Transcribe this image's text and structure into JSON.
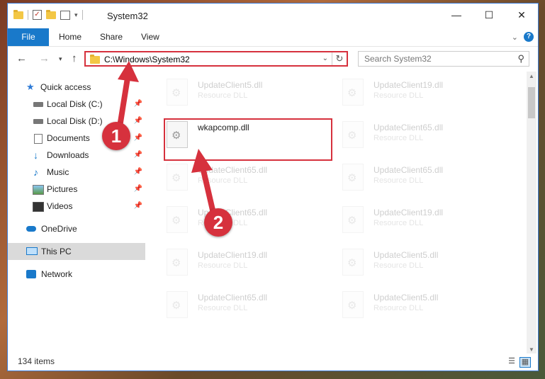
{
  "window": {
    "title": "System32"
  },
  "ribbon": {
    "tabs": {
      "file": "File",
      "home": "Home",
      "share": "Share",
      "view": "View"
    }
  },
  "nav": {
    "address": "C:\\Windows\\System32",
    "search_placeholder": "Search System32"
  },
  "sidebar": {
    "items": [
      {
        "label": "Quick access",
        "icon": "star-icon"
      },
      {
        "label": "Local Disk (C:)",
        "icon": "disk-icon"
      },
      {
        "label": "Local Disk (D:)",
        "icon": "disk-icon"
      },
      {
        "label": "Documents",
        "icon": "documents-icon"
      },
      {
        "label": "Downloads",
        "icon": "downloads-icon"
      },
      {
        "label": "Music",
        "icon": "music-icon"
      },
      {
        "label": "Pictures",
        "icon": "pictures-icon"
      },
      {
        "label": "Videos",
        "icon": "videos-icon"
      },
      {
        "label": "OneDrive",
        "icon": "onedrive-icon"
      },
      {
        "label": "This PC",
        "icon": "this-pc-icon"
      },
      {
        "label": "Network",
        "icon": "network-icon"
      }
    ]
  },
  "files": {
    "c0": [
      {
        "name": "UpdateClient5.dll",
        "type": "Resource DLL"
      },
      {
        "name": "wkapcomp.dll",
        "type": ""
      },
      {
        "name": "UpdateClient65.dll",
        "type": "Resource DLL"
      },
      {
        "name": "UpdateClient65.dll",
        "type": "Resource DLL"
      },
      {
        "name": "UpdateClient19.dll",
        "type": "Resource DLL"
      },
      {
        "name": "UpdateClient65.dll",
        "type": "Resource DLL"
      }
    ],
    "c1": [
      {
        "name": "UpdateClient19.dll",
        "type": "Resource DLL"
      },
      {
        "name": "UpdateClient65.dll",
        "type": "Resource DLL"
      },
      {
        "name": "UpdateClient65.dll",
        "type": "Resource DLL"
      },
      {
        "name": "UpdateClient19.dll",
        "type": "Resource DLL"
      },
      {
        "name": "UpdateClient5.dll",
        "type": "Resource DLL"
      },
      {
        "name": "UpdateClient5.dll",
        "type": "Resource DLL"
      }
    ]
  },
  "status": {
    "items_count": "134 items"
  },
  "annotations": {
    "step1": "1",
    "step2": "2"
  },
  "colors": {
    "accent": "#1979ca",
    "highlight": "#d6313d"
  }
}
